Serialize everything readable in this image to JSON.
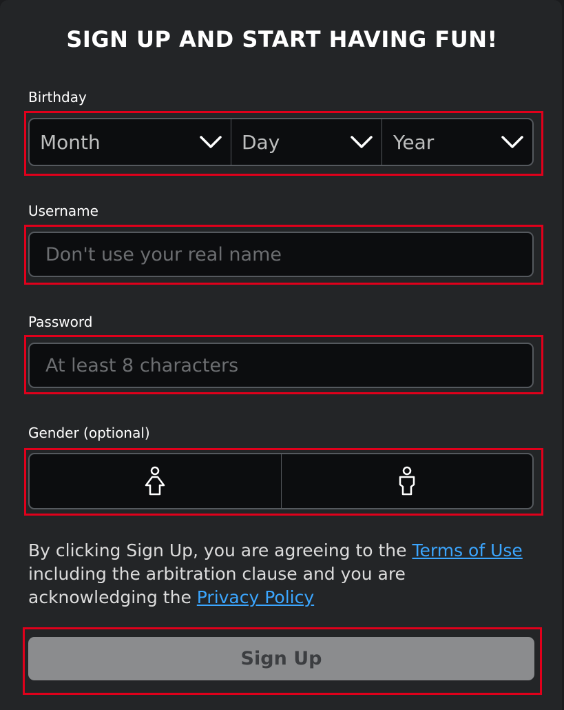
{
  "title": "SIGN UP AND START HAVING FUN!",
  "birthday": {
    "label": "Birthday",
    "month": "Month",
    "day": "Day",
    "year": "Year"
  },
  "username": {
    "label": "Username",
    "placeholder": "Don't use your real name"
  },
  "password": {
    "label": "Password",
    "placeholder": "At least 8 characters"
  },
  "gender": {
    "label": "Gender (optional)",
    "options": [
      {
        "icon": "female-icon"
      },
      {
        "icon": "male-icon"
      }
    ]
  },
  "legal": {
    "prefix": "By clicking Sign Up, you are agreeing to the ",
    "terms_link": "Terms of Use",
    "middle": " including the arbitration clause and you are acknowledging the ",
    "privacy_link": "Privacy Policy"
  },
  "signup_button": "Sign Up",
  "colors": {
    "panel": "#232527",
    "input_bg": "#0c0d0f",
    "link": "#3ba6ff",
    "button_disabled": "#8b8c8e",
    "highlight": "#e0001b"
  }
}
